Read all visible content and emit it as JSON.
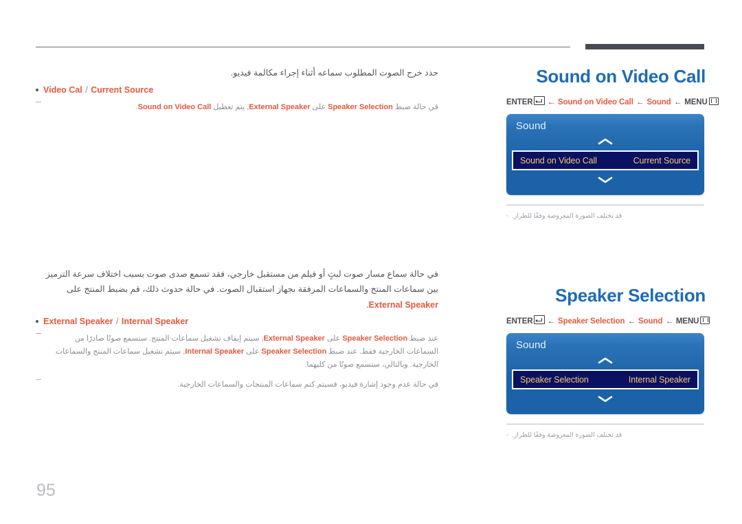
{
  "page": {
    "number": "95",
    "footnote_caption": "قد تختلف الصورة المعروضة وفقًا للطراز.",
    "caption_dash": "-"
  },
  "icons": {
    "enter": "enter-key-icon",
    "menu": "menu-key-icon",
    "chevron_up": "chevron-up-icon",
    "chevron_down": "chevron-down-icon",
    "bullet": "bullet-dot-icon",
    "note_mark": "note-dash-icon"
  },
  "colors": {
    "title_blue": "#1f6cb4",
    "accent_orange": "#e4593d",
    "osd_blue": "#1c62a8",
    "osd_row_navy": "#0b1162",
    "osd_row_gold": "#f3c96b",
    "rule_dark": "#4a4a55",
    "muted": "#9a9ea8"
  },
  "sections": [
    {
      "id": "sound-on-video-call",
      "title": "Sound on Video Call",
      "breadcrumb": {
        "enter_label": "ENTER",
        "menu_label": "MENU",
        "arrow": "←",
        "crumbs": [
          "Sound on Video Call",
          "Sound"
        ]
      },
      "osd": {
        "panel_title": "Sound",
        "row_label": "Sound on Video Call",
        "row_value": "Current Source"
      },
      "lead": "حدد خرج الصوت المطلوب سماعه أثناء إجراء مكالمة فيديو.",
      "bullet": {
        "left": "Video Cal",
        "sep": "/",
        "right": "Current Source"
      },
      "notes": [
        {
          "parts": [
            {
              "t": "في حالة ضبط ",
              "hl": false
            },
            {
              "t": "Speaker Selection",
              "hl": true
            },
            {
              "t": " على ",
              "hl": false
            },
            {
              "t": "External Speaker",
              "hl": true
            },
            {
              "t": ", يتم تعطيل ",
              "hl": false
            },
            {
              "t": "Sound on Video Call",
              "hl": true
            },
            {
              "t": ".",
              "hl": false
            }
          ]
        }
      ]
    },
    {
      "id": "speaker-selection",
      "title": "Speaker Selection",
      "breadcrumb": {
        "enter_label": "ENTER",
        "menu_label": "MENU",
        "arrow": "←",
        "crumbs": [
          "Speaker Selection",
          "Sound"
        ]
      },
      "osd": {
        "panel_title": "Sound",
        "row_label": "Speaker Selection",
        "row_value": "Internal Speaker"
      },
      "paragraph_parts": [
        {
          "t": "في حالة سماع مسار صوت لبثٍ أو فيلم من مستقبل خارجي، فقد تسمع صدى صوت بسبب اختلاف سرعة الترميز بين سماعات المنتج والسماعات المرفقة بجهاز استقبال الصوت. في حالة حدوث ذلك، قم بضبط المنتج على ",
          "hl": false
        },
        {
          "t": "External Speaker",
          "hl": true
        },
        {
          "t": ".",
          "hl": false
        }
      ],
      "bullet": {
        "left": "External Speaker",
        "sep": "/",
        "right": "Internal Speaker"
      },
      "notes": [
        {
          "parts": [
            {
              "t": "عند ضبط ",
              "hl": false
            },
            {
              "t": "Speaker Selection",
              "hl": true
            },
            {
              "t": " على ",
              "hl": false
            },
            {
              "t": "External Speaker",
              "hl": true
            },
            {
              "t": ", سيتم إيقاف تشغيل سماعات المنتج. ستسمع صوتًا صادرًا من السماعات الخارجية فقط. عند ضبط ",
              "hl": false
            },
            {
              "t": "Speaker Selection",
              "hl": true
            },
            {
              "t": " على ",
              "hl": false
            },
            {
              "t": "Internal Speaker",
              "hl": true
            },
            {
              "t": ", سيتم تشغيل سماعات المنتج والسماعات الخارجية. وبالتالي، ستسمع صوتًا من كليهما.",
              "hl": false
            }
          ]
        },
        {
          "parts": [
            {
              "t": "في حالة عدم وجود إشارة فيديو، فسيتم كتم سماعات المنتجات والسماعات الخارجية.",
              "hl": false
            }
          ]
        }
      ]
    }
  ]
}
